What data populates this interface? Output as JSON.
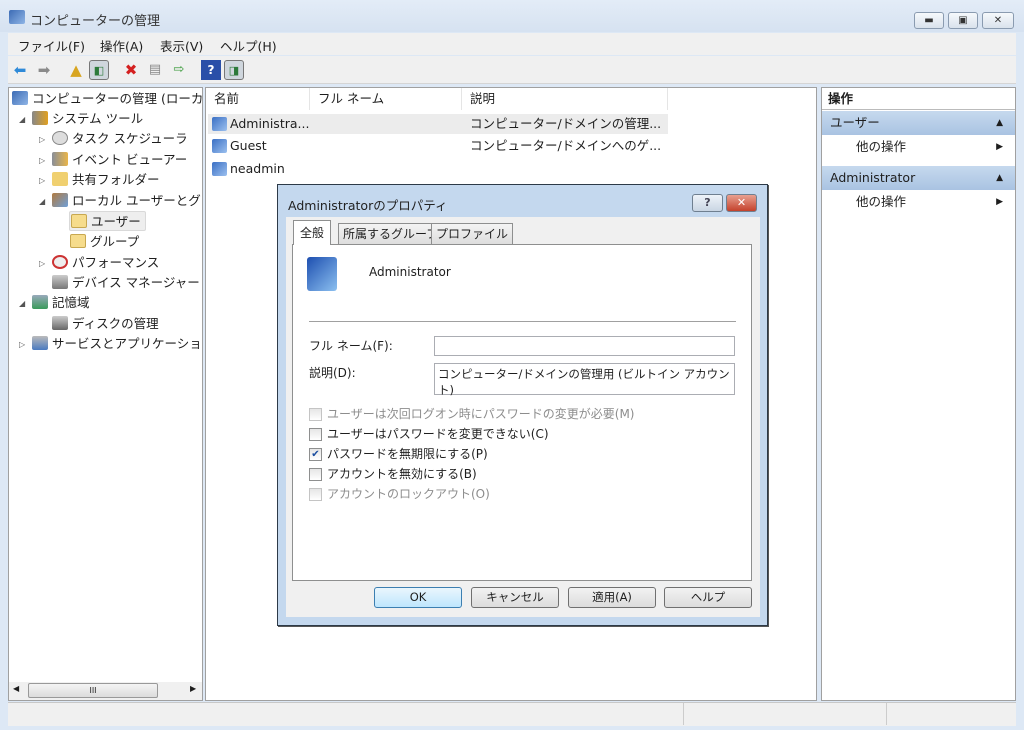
{
  "window": {
    "title": "コンピューターの管理",
    "minimize": "▬",
    "maximize": "▣",
    "close": "✕"
  },
  "menu": [
    "ファイル(F)",
    "操作(A)",
    "表示(V)",
    "ヘルプ(H)"
  ],
  "tree": [
    {
      "label": "コンピューターの管理 (ローカ"
    },
    {
      "label": "システム ツール"
    },
    {
      "label": "タスク スケジューラ"
    },
    {
      "label": "イベント ビューアー"
    },
    {
      "label": "共有フォルダー"
    },
    {
      "label": "ローカル ユーザーとグ"
    },
    {
      "label": "ユーザー"
    },
    {
      "label": "グループ"
    },
    {
      "label": "パフォーマンス"
    },
    {
      "label": "デバイス マネージャー"
    },
    {
      "label": "記憶域"
    },
    {
      "label": "ディスクの管理"
    },
    {
      "label": "サービスとアプリケーショ"
    }
  ],
  "scrollbar": {
    "grip": "III"
  },
  "list": {
    "columns": [
      "名前",
      "フル ネーム",
      "説明"
    ],
    "rows": [
      {
        "name": "Administra...",
        "fullname": "",
        "desc": "コンピューター/ドメインの管理..."
      },
      {
        "name": "Guest",
        "fullname": "",
        "desc": "コンピューター/ドメインへのゲ..."
      },
      {
        "name": "neadmin",
        "fullname": "",
        "desc": ""
      }
    ]
  },
  "actions": {
    "header": "操作",
    "sections": [
      {
        "title": "ユーザー",
        "item": "他の操作"
      },
      {
        "title": "Administrator",
        "item": "他の操作"
      }
    ]
  },
  "dialog": {
    "title": "Administratorのプロパティ",
    "help": "?",
    "close": "✕",
    "tabs": [
      "全般",
      "所属するグループ",
      "プロファイル"
    ],
    "username": "Administrator",
    "fullname_label": "フル ネーム(F):",
    "fullname_value": "",
    "desc_label": "説明(D):",
    "desc_value": "コンピューター/ドメインの管理用 (ビルトイン アカウント)",
    "checkboxes": [
      {
        "label": "ユーザーは次回ログオン時にパスワードの変更が必要(M)",
        "checked": false,
        "disabled": true
      },
      {
        "label": "ユーザーはパスワードを変更できない(C)",
        "checked": false,
        "disabled": false
      },
      {
        "label": "パスワードを無期限にする(P)",
        "checked": true,
        "disabled": false
      },
      {
        "label": "アカウントを無効にする(B)",
        "checked": false,
        "disabled": false
      },
      {
        "label": "アカウントのロックアウト(O)",
        "checked": false,
        "disabled": true
      }
    ],
    "buttons": [
      "OK",
      "キャンセル",
      "適用(A)",
      "ヘルプ"
    ]
  },
  "colors": {
    "accent": "#a9c3e2",
    "dialog_frame": "#c4d8ee"
  }
}
